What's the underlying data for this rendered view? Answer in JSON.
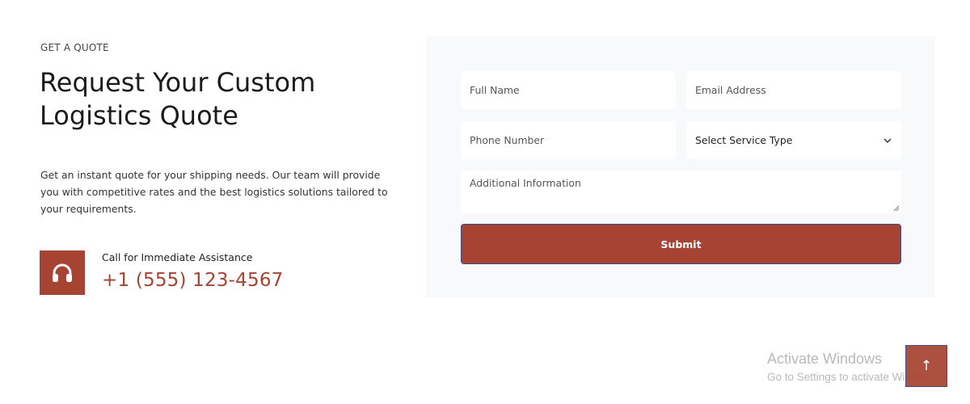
{
  "section": {
    "eyebrow": "GET A QUOTE",
    "title": "Request Your Custom Logistics Quote",
    "description": "Get an instant quote for your shipping needs. Our team will provide you with competitive rates and the best logistics solutions tailored to your requirements."
  },
  "call": {
    "icon": "headphones-icon",
    "label": "Call for Immediate Assistance",
    "phone": "+1 (555) 123-4567"
  },
  "form": {
    "name_placeholder": "Full Name",
    "email_placeholder": "Email Address",
    "phone_placeholder": "Phone Number",
    "service_selected": "Select Service Type",
    "info_placeholder": "Additional Information",
    "submit_label": "Submit"
  },
  "watermark": {
    "title": "Activate Windows",
    "subtitle": "Go to Settings to activate Windows."
  },
  "scroll_top": {
    "icon": "arrow-up-icon",
    "glyph": "↑"
  },
  "colors": {
    "accent": "#a64332",
    "panel_bg": "#f8f9fa"
  }
}
